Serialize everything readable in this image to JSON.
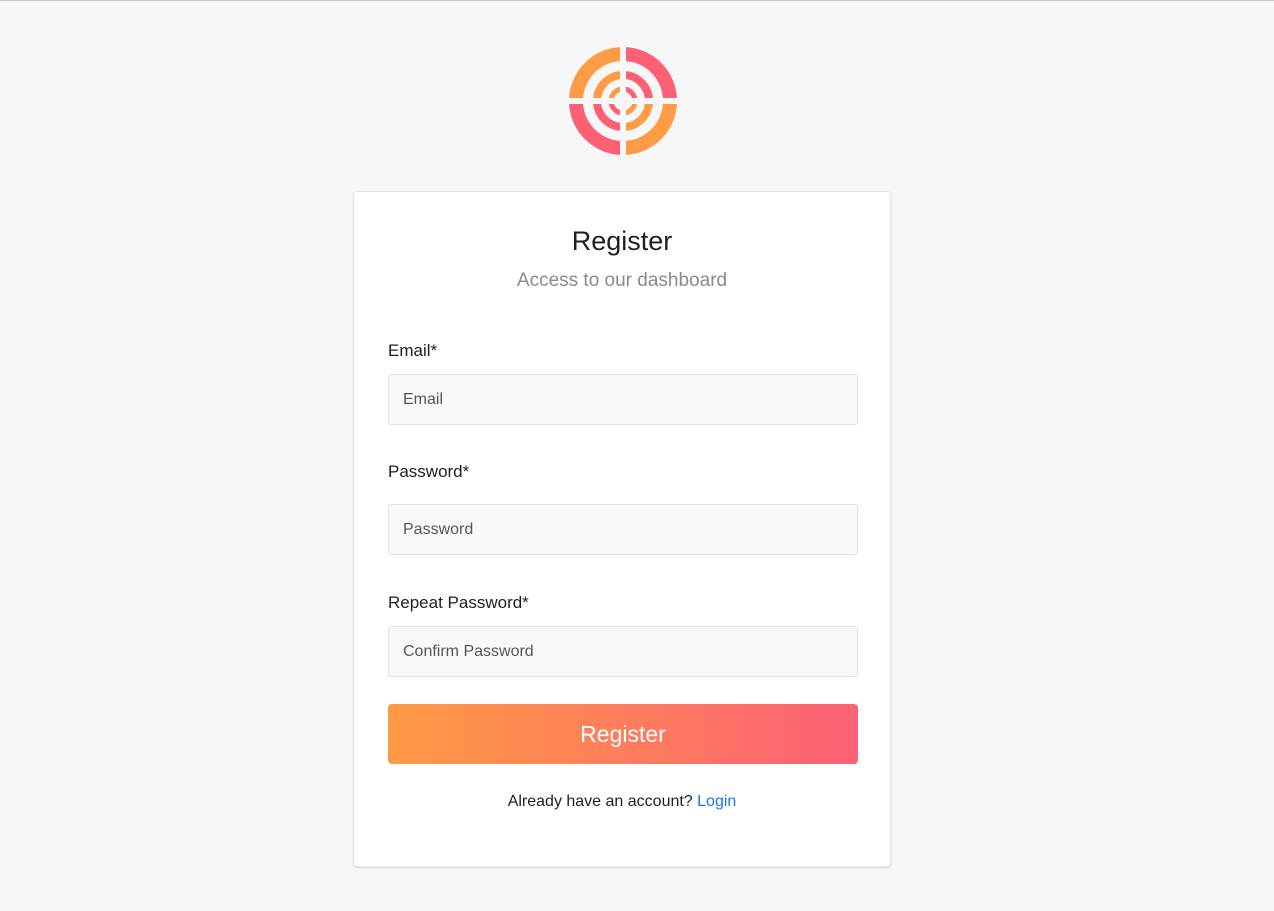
{
  "logo": {
    "icon": "target-logo-icon",
    "colors": {
      "orange": "#ff9b44",
      "pink": "#fc6075"
    }
  },
  "form": {
    "title": "Register",
    "subtitle": "Access to our dashboard",
    "email": {
      "label": "Email*",
      "placeholder": "Email",
      "value": ""
    },
    "password": {
      "label": "Password*",
      "placeholder": "Password",
      "value": ""
    },
    "repeat_password": {
      "label": "Repeat Password*",
      "placeholder": "Confirm Password",
      "value": ""
    },
    "submit_label": "Register"
  },
  "footer": {
    "text": "Already have an account?",
    "link_label": "Login"
  },
  "colors": {
    "accent_gradient_start": "#ff9b44",
    "accent_gradient_end": "#fc6075",
    "link": "#1a73e8",
    "background": "#f7f7f7"
  }
}
